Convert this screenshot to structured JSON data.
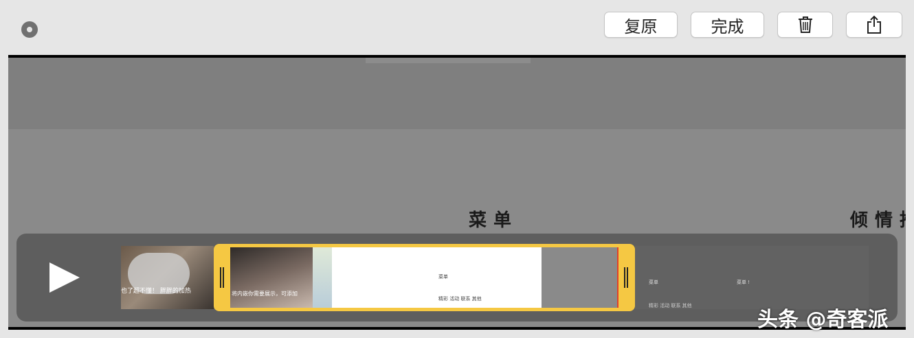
{
  "toolbar": {
    "revert_label": "复原",
    "done_label": "完成",
    "trash_icon": "trash-icon",
    "share_icon": "share-icon"
  },
  "preview": {
    "heading_menu": "菜单",
    "heading_right": "倾情推"
  },
  "timeline": {
    "thumb_text_1": "也了超不懂！ 胖胖的加热",
    "thumb_text_2": "将内嵌你需要展示，可添加",
    "thumb_menu_label": "菜单",
    "thumb_menu_label2": "菜单 !",
    "thumb_menu_items": "精彩  活动  联系  其他"
  },
  "watermark": "头条 @奇客派"
}
